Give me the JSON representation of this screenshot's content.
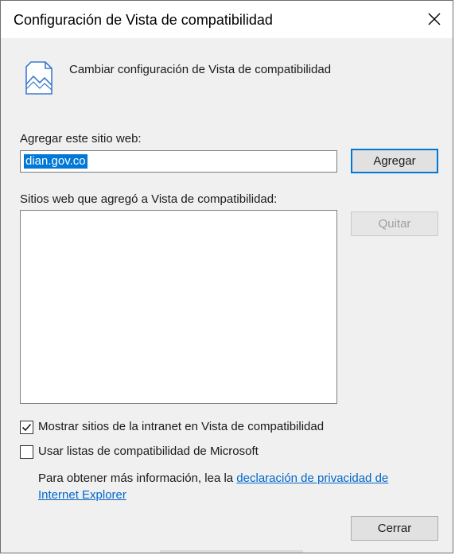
{
  "window": {
    "title": "Configuración de Vista de compatibilidad",
    "close_icon": "close-icon"
  },
  "header": {
    "icon": "broken-page-icon",
    "text": "Cambiar configuración de Vista de compatibilidad"
  },
  "add_site": {
    "label": "Agregar este sitio web:",
    "value": "dian.gov.co",
    "button_label": "Agregar"
  },
  "sites_list": {
    "label": "Sitios web que agregó a Vista de compatibilidad:",
    "items": [],
    "remove_button_label": "Quitar"
  },
  "options": {
    "intranet": {
      "label": "Mostrar sitios de la intranet en Vista de compatibilidad",
      "checked": true
    },
    "microsoft_lists": {
      "label": "Usar listas de compatibilidad de Microsoft",
      "checked": false
    }
  },
  "info": {
    "prefix": "Para obtener más información, lea la ",
    "link_text": "declaración de privacidad de Internet Explorer"
  },
  "footer": {
    "close_button_label": "Cerrar"
  },
  "colors": {
    "accent": "#0078d7",
    "link": "#0066cc",
    "dialog_bg": "#f0f0f0"
  }
}
